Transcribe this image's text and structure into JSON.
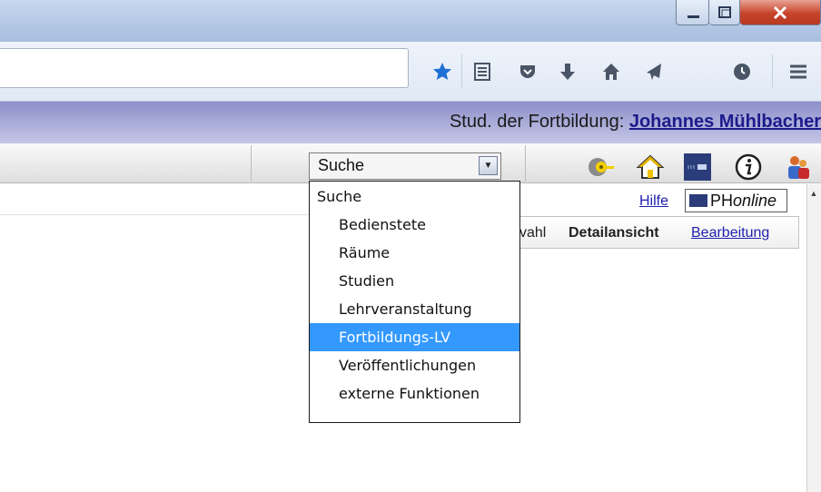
{
  "window": {
    "minimize_icon": "minimize-icon",
    "maximize_icon": "maximize-icon",
    "close_icon": "close-icon"
  },
  "toolbar_icons": [
    "bookmark-star-icon",
    "reading-list-icon",
    "pocket-icon",
    "download-icon",
    "home-icon",
    "send-icon",
    "history-icon",
    "menu-icon"
  ],
  "header": {
    "prefix": "Stud. der Fortbildung:",
    "user_name": "Johannes Mühlbacher"
  },
  "search_select": {
    "value": "Suche"
  },
  "dropdown": {
    "items": [
      {
        "label": "Suche",
        "indent": 0,
        "selected": false
      },
      {
        "label": "Bedienstete",
        "indent": 1,
        "selected": false
      },
      {
        "label": "Räume",
        "indent": 1,
        "selected": false
      },
      {
        "label": "Studien",
        "indent": 1,
        "selected": false
      },
      {
        "label": "Lehrveranstaltung",
        "indent": 1,
        "selected": false
      },
      {
        "label": "Fortbildungs-LV",
        "indent": 1,
        "selected": true
      },
      {
        "label": "Veröffentlichungen",
        "indent": 1,
        "selected": false
      },
      {
        "label": "externe Funktionen",
        "indent": 1,
        "selected": false
      }
    ]
  },
  "content": {
    "help_link": "Hilfe",
    "brand": {
      "ph": "PH",
      "online": "online"
    },
    "tabs": {
      "wahl_partial": "vahl",
      "detail": "Detailansicht",
      "bearbeitung": "Bearbeitung"
    }
  },
  "colors": {
    "header_band": "#a9abd8",
    "link": "#1f1fb0",
    "dropdown_highlight": "#3399ff",
    "close_button": "#c7432a"
  }
}
